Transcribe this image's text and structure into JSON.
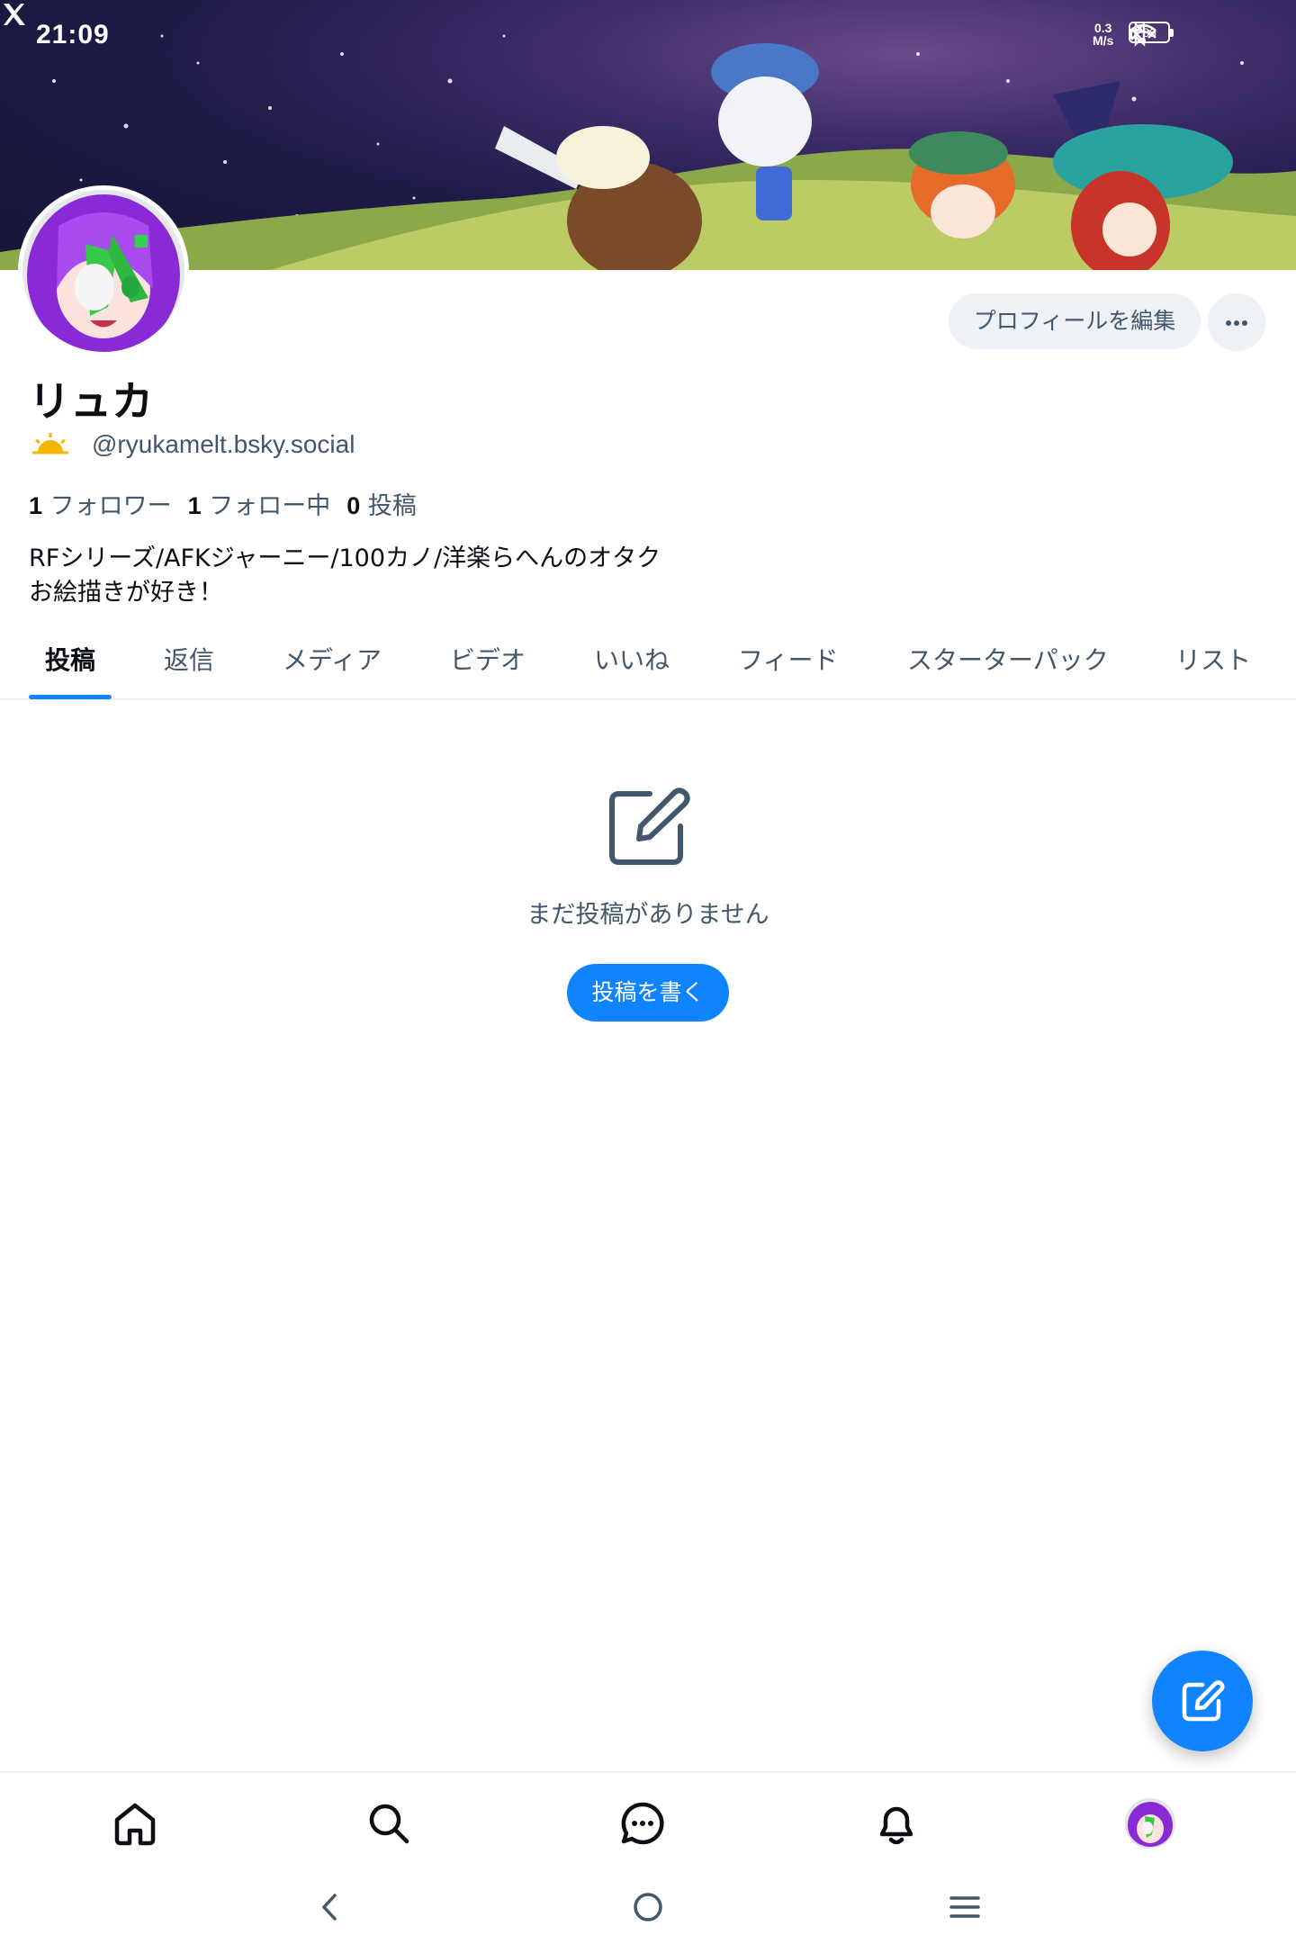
{
  "status_bar": {
    "time": "21:09",
    "app_icon": "x-logo-icon",
    "net_speed_value": "0.3",
    "net_speed_unit": "M/s",
    "icons": [
      "bluetooth-icon",
      "mute-icon",
      "wifi-icon"
    ],
    "battery": "86"
  },
  "profile": {
    "display_name": "リュカ",
    "handle": "@ryukamelt.bsky.social",
    "handle_badge_icon": "sun-icon",
    "edit_button": "プロフィールを編集",
    "more_button_icon": "more-dots-icon",
    "stats": {
      "followers_count": "1",
      "followers_label": "フォロワー",
      "following_count": "1",
      "following_label": "フォロー中",
      "posts_count": "0",
      "posts_label": "投稿"
    },
    "bio_line1": "RFシリーズ/AFKジャーニー/100カノ/洋楽らへんのオタク",
    "bio_line2": "お絵描きが好き！"
  },
  "tabs": [
    {
      "label": "投稿",
      "active": true
    },
    {
      "label": "返信",
      "active": false
    },
    {
      "label": "メディア",
      "active": false
    },
    {
      "label": "ビデオ",
      "active": false
    },
    {
      "label": "いいね",
      "active": false
    },
    {
      "label": "フィード",
      "active": false
    },
    {
      "label": "スターターパック",
      "active": false
    },
    {
      "label": "リスト",
      "active": false
    }
  ],
  "empty_state": {
    "icon": "edit-square-icon",
    "message": "まだ投稿がありません",
    "button": "投稿を書く"
  },
  "fab_icon": "compose-icon",
  "bottom_nav": [
    "home-icon",
    "search-icon",
    "chat-icon",
    "bell-icon",
    "profile-avatar"
  ],
  "system_nav": [
    "back-icon",
    "home-circle-icon",
    "menu-icon"
  ],
  "colors": {
    "accent": "#1083fe",
    "text_primary": "#0b0f14",
    "text_secondary": "#42576c",
    "button_bg": "#eef1f5"
  }
}
